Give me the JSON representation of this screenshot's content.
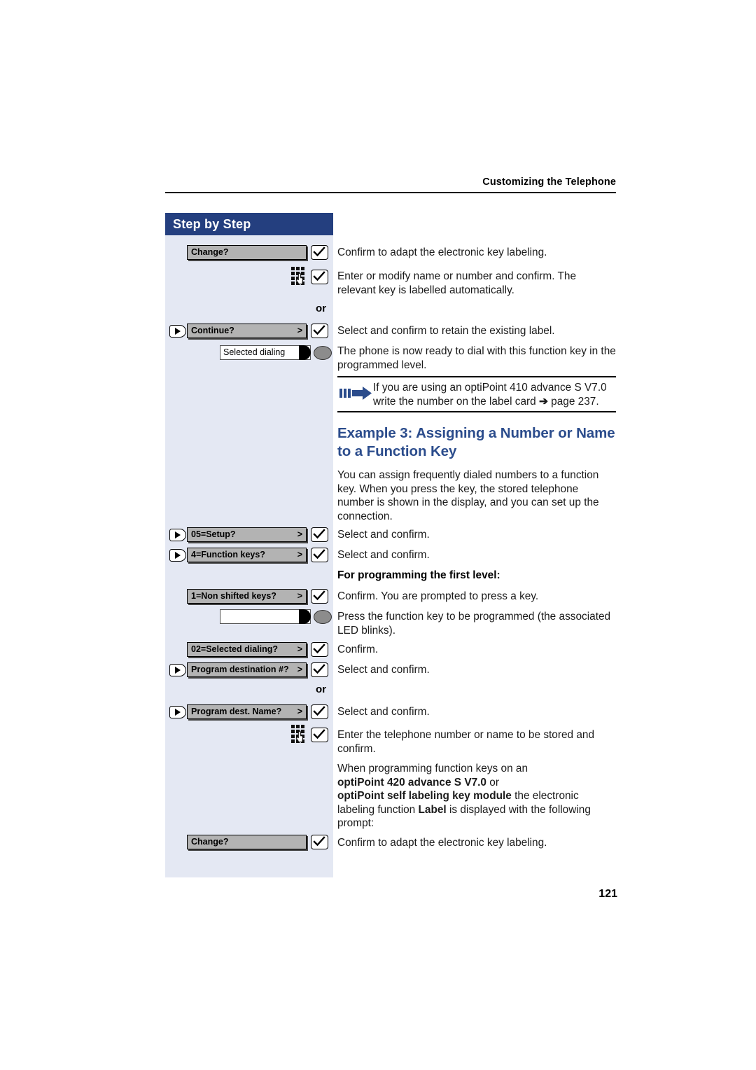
{
  "header": {
    "running_title": "Customizing the Telephone"
  },
  "sidebar": {
    "title": "Step by Step",
    "or_label": "or",
    "rows": [
      {
        "id": "change-1",
        "type": "menu",
        "label": "Change?",
        "arrow": "",
        "has_nav": false,
        "has_ok": true
      },
      {
        "id": "keypad-1",
        "type": "keypad",
        "label": "",
        "arrow": "",
        "has_nav": false,
        "has_ok": true
      },
      {
        "id": "continue",
        "type": "menu",
        "label": "Continue?",
        "arrow": ">",
        "has_nav": true,
        "has_ok": true
      },
      {
        "id": "selected-dialing-key",
        "type": "fkey",
        "label": "Selected dialing",
        "arrow": "",
        "has_nav": false,
        "has_ok": false
      },
      {
        "id": "setup",
        "type": "menu",
        "label": "05=Setup?",
        "arrow": ">",
        "has_nav": true,
        "has_ok": true
      },
      {
        "id": "function-keys",
        "type": "menu",
        "label": "4=Function keys?",
        "arrow": ">",
        "has_nav": true,
        "has_ok": true
      },
      {
        "id": "non-shifted-keys",
        "type": "menu",
        "label": "1=Non shifted keys?",
        "arrow": ">",
        "has_nav": false,
        "has_ok": true
      },
      {
        "id": "blank-key",
        "type": "fkey",
        "label": "",
        "arrow": "",
        "has_nav": false,
        "has_ok": false
      },
      {
        "id": "selected-dialing-opt",
        "type": "menu",
        "label": "02=Selected dialing?",
        "arrow": ">",
        "has_nav": false,
        "has_ok": true
      },
      {
        "id": "program-dest-num",
        "type": "menu",
        "label": "Program destination #?",
        "arrow": ">",
        "has_nav": true,
        "has_ok": true
      },
      {
        "id": "program-dest-name",
        "type": "menu",
        "label": "Program dest. Name?",
        "arrow": ">",
        "has_nav": true,
        "has_ok": true
      },
      {
        "id": "keypad-2",
        "type": "keypad",
        "label": "",
        "arrow": "",
        "has_nav": false,
        "has_ok": true
      },
      {
        "id": "change-2",
        "type": "menu",
        "label": "Change?",
        "arrow": "",
        "has_nav": false,
        "has_ok": true
      }
    ]
  },
  "content": {
    "p_confirm_adapt_1": "Confirm to adapt the electronic key labeling.",
    "p_enter_modify": "Enter or modify name or number and confirm. The relevant key is labelled automatically.",
    "p_select_retain": "Select and confirm to retain the existing label.",
    "p_ready_to_dial": "The phone is now ready to dial with this function key in the programmed level.",
    "note": {
      "line1": "If you are using an optiPoint 410 advance S V7.0",
      "line2_a": "write the number on the label card ",
      "line2_arrow": "➔",
      "line2_b": " page 237."
    },
    "example_heading": "Example 3: Assigning a Number or Name to a Function Key",
    "p_assign_intro": "You can assign frequently dialed numbers to a function key. When you press the key, the stored telephone number is shown in the display, and you can set up the connection.",
    "p_select_confirm_1": "Select and confirm.",
    "p_select_confirm_2": "Select and confirm.",
    "h_first_level": "For programming the first level:",
    "p_confirm_prompted": "Confirm. You are prompted to press a key.",
    "p_press_function_key": "Press the function key to be programmed (the associated LED blinks).",
    "p_confirm": "Confirm.",
    "p_select_confirm_3": "Select and confirm.",
    "or_label": "or",
    "p_select_confirm_4": "Select and confirm.",
    "p_enter_number": "Enter the telephone number or name to be stored and confirm.",
    "p_when_programming": {
      "t1": "When programming function keys on an",
      "b1": "optiPoint 420 advance S V7.0",
      "t2": " or",
      "b2": "optiPoint self labeling key module",
      "t3": " the electronic labeling function ",
      "b3": "Label",
      "t4": " is displayed with the following prompt:"
    },
    "p_confirm_adapt_2": "Confirm to adapt the electronic key labeling."
  },
  "footer": {
    "page_number": "121"
  },
  "colors": {
    "sidebar_bg": "#e4e8f3",
    "sidebar_title_bg": "#243f7f",
    "heading_blue": "#2b4c8c",
    "menu_grey": "#b3b3b3",
    "led_grey": "#8c8c8c"
  }
}
